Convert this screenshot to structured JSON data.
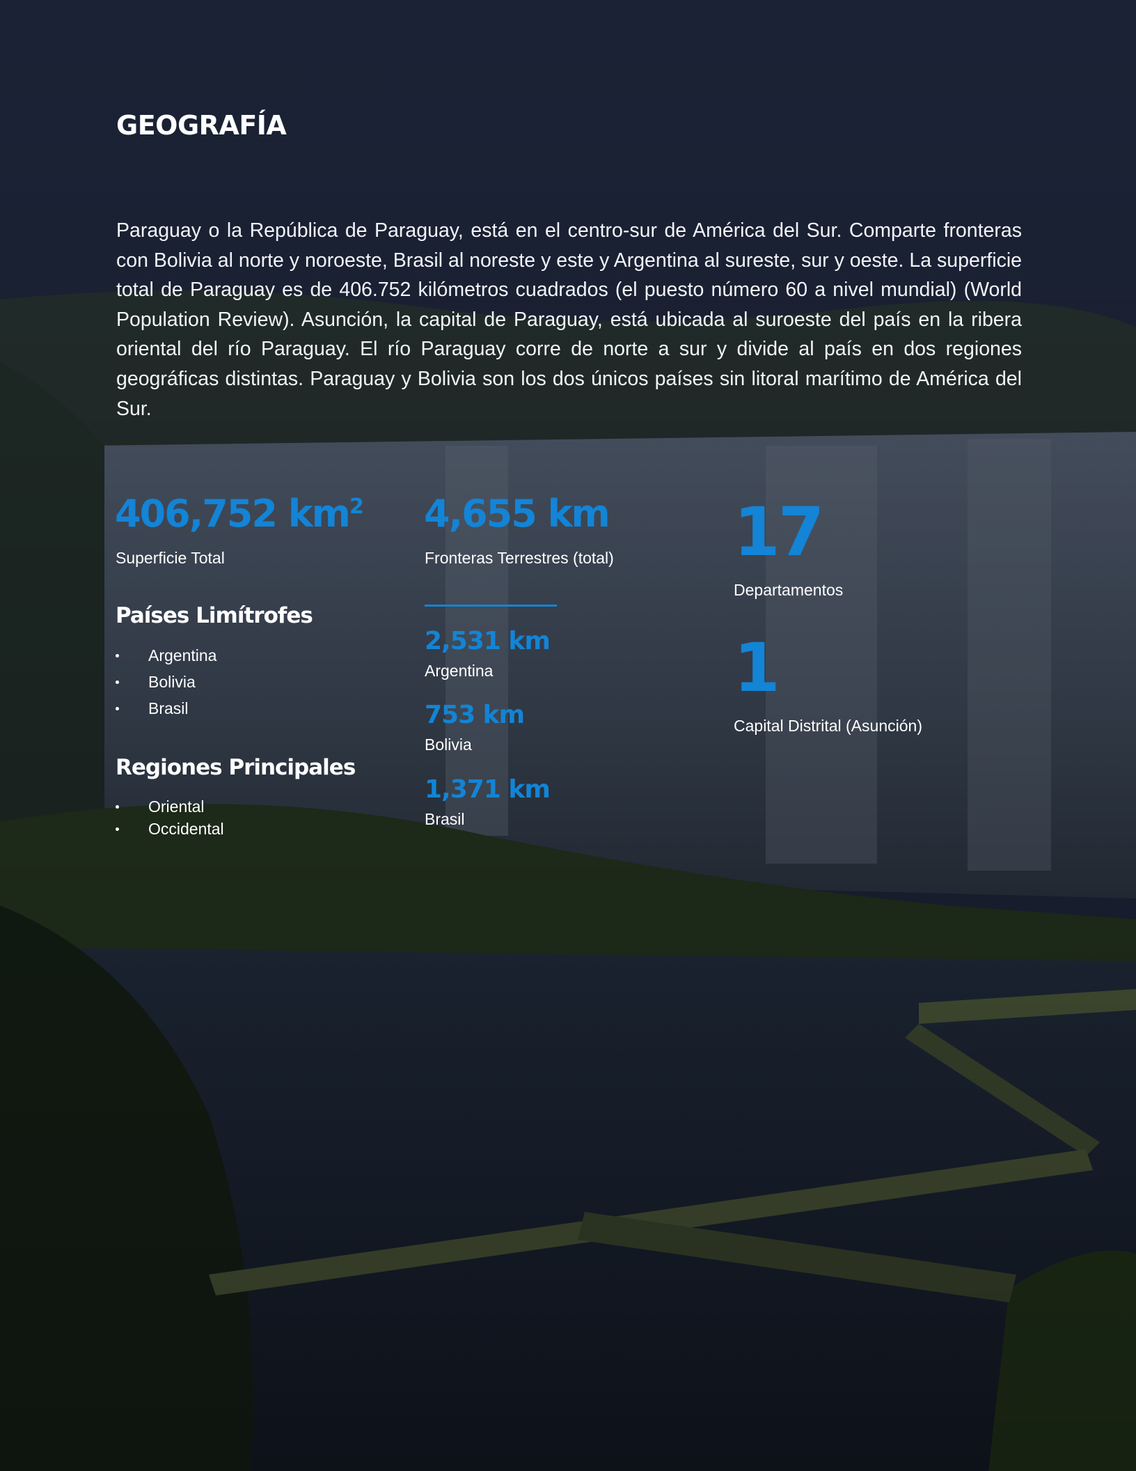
{
  "page": {
    "title": "GEOGRAFÍA",
    "intro": "Paraguay o la República de Paraguay, está en el centro-sur de América del Sur. Comparte fronteras con Bolivia al norte y noroeste, Brasil al noreste y este y Argentina al sureste, sur y oeste. La superficie total de Paraguay es de 406.752 kilómetros cuadrados (el puesto número 60 a nivel mundial) (World Population Review). Asunción, la capital de Paraguay, está ubicada al suroeste del país en la ribera oriental del río Paraguay. El río Paraguay corre de norte a sur y divide al país en dos regiones geográficas distintas. Paraguay y Bolivia son los dos únicos países sin litoral marítimo de América del Sur."
  },
  "stats": {
    "area": {
      "value": "406,752 km",
      "superscript": "2",
      "label": "Superficie Total"
    },
    "borders": {
      "value": "4,655 km",
      "label": "Fronteras Terrestres (total)"
    },
    "departments": {
      "value": "17",
      "label": "Departamentos"
    },
    "capital": {
      "value": "1",
      "label": "Capital Distrital (Asunción)"
    }
  },
  "neighbors": {
    "heading": "Países Limítrofes",
    "items": [
      "Argentina",
      "Bolivia",
      "Brasil"
    ]
  },
  "regions": {
    "heading": "Regiones Principales",
    "items": [
      "Oriental",
      "Occidental"
    ]
  },
  "border_breakdown": [
    {
      "value": "2,531 km",
      "label": "Argentina"
    },
    {
      "value": "753 km",
      "label": "Bolivia"
    },
    {
      "value": "1,371 km",
      "label": "Brasil"
    }
  ],
  "colors": {
    "accent": "#1384d6",
    "overlay": "#1b2234",
    "text": "#ffffff"
  }
}
